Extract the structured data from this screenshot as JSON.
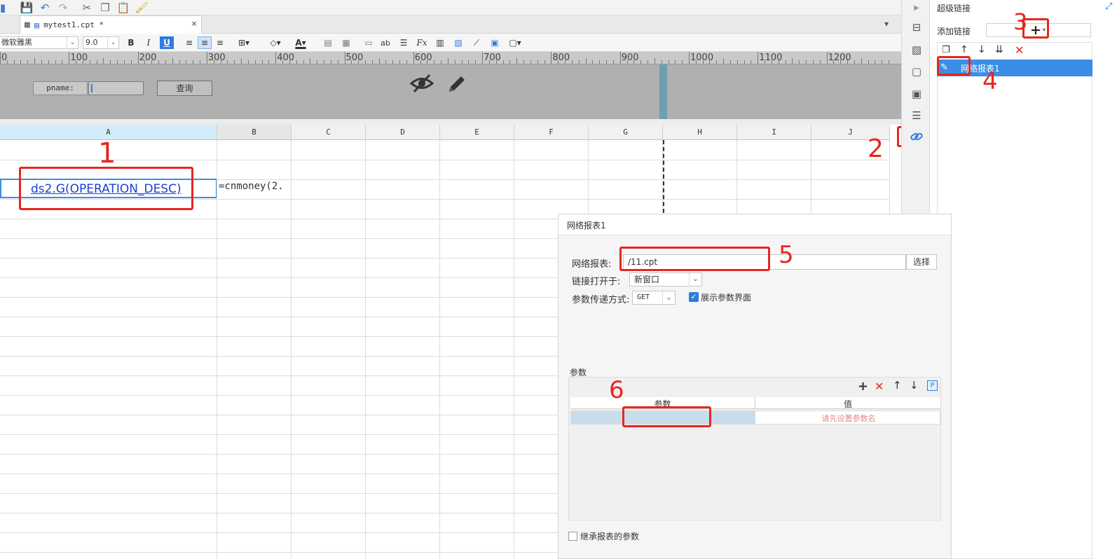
{
  "tab": {
    "title": "mytest1.cpt *"
  },
  "format": {
    "font_name": "微软雅黑",
    "font_size": "9.0"
  },
  "ruler": {
    "labels": [
      "0",
      "100",
      "200",
      "300",
      "400",
      "500",
      "600",
      "700",
      "800",
      "900",
      "1000",
      "1100",
      "1200"
    ]
  },
  "param_pane": {
    "pname_label": "pname:",
    "query_button": "查询"
  },
  "sheet": {
    "columns": [
      "A",
      "B",
      "C",
      "D",
      "E",
      "F",
      "G",
      "H",
      "I",
      "J"
    ],
    "cell_a3": "ds2.G(OPERATION_DESC)",
    "cell_b3": "=cnmoney(2."
  },
  "right_panel": {
    "title": "超级链接",
    "add_link_label": "添加链接",
    "link_item": "网络报表1"
  },
  "dialog": {
    "title": "网络报表1",
    "report_label": "网络报表:",
    "report_value": "/11.cpt",
    "choose_button": "选择",
    "open_in_label": "链接打开于:",
    "open_in_value": "新窗口",
    "method_label": "参数传递方式:",
    "method_value": "GET",
    "show_params_label": "展示参数界面",
    "show_params_checked": true,
    "params_section": "参数",
    "col_param": "参数",
    "col_value": "值",
    "value_placeholder": "请先设置参数名",
    "inherit_label": "继承报表的参数"
  },
  "annotations": [
    "1",
    "2",
    "3",
    "4",
    "5",
    "6"
  ],
  "colors": {
    "accent": "#2d7de0",
    "annotation": "#e8261e",
    "selection": "#3a8ee6"
  }
}
